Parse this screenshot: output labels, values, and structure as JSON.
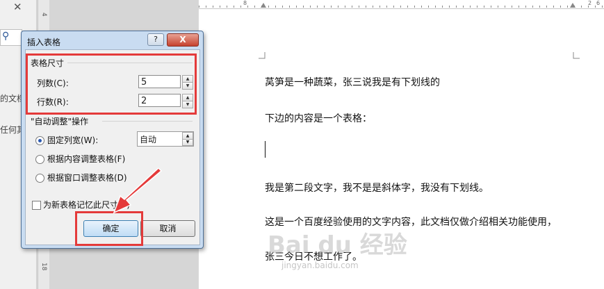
{
  "left_pane": {
    "close_glyph": "✕",
    "search_icon": "search-icon",
    "snippets": [
      "的文档",
      "任何其"
    ]
  },
  "ruler": {
    "h_marks": [
      "8",
      "2",
      "6"
    ],
    "v_marks": [
      "4",
      "18"
    ]
  },
  "document": {
    "lines": [
      "莴笋是一种蔬菜，张三说我是有下划线的",
      "下边的内容是一个表格：",
      "我是第二段文字，我不是是斜体字，我没有下划线。",
      "这是一个百度经验使用的文字内容，此文档仅做介绍相关功能使用，",
      "张三今日不想工作了。"
    ]
  },
  "watermark": {
    "logo": "Bai du 经验",
    "url": "jingyan.baidu.com"
  },
  "dialog": {
    "title": "插入表格",
    "help_label": "?",
    "close_label": "X",
    "size_section": "表格尺寸",
    "columns_label": "列数(C):",
    "columns_value": "5",
    "rows_label": "行数(R):",
    "rows_value": "2",
    "autofit_section": "\"自动调整\"操作",
    "fixed_width_label": "固定列宽(W):",
    "fixed_width_value": "自动",
    "fit_content_label": "根据内容调整表格(F)",
    "fit_window_label": "根据窗口调整表格(D)",
    "selected_option": "fixed_width",
    "remember_label": "为新表格记忆此尺寸(S)",
    "remember_checked": false,
    "ok_label": "确定",
    "cancel_label": "取消"
  },
  "annotation_color": "#e43a3a"
}
